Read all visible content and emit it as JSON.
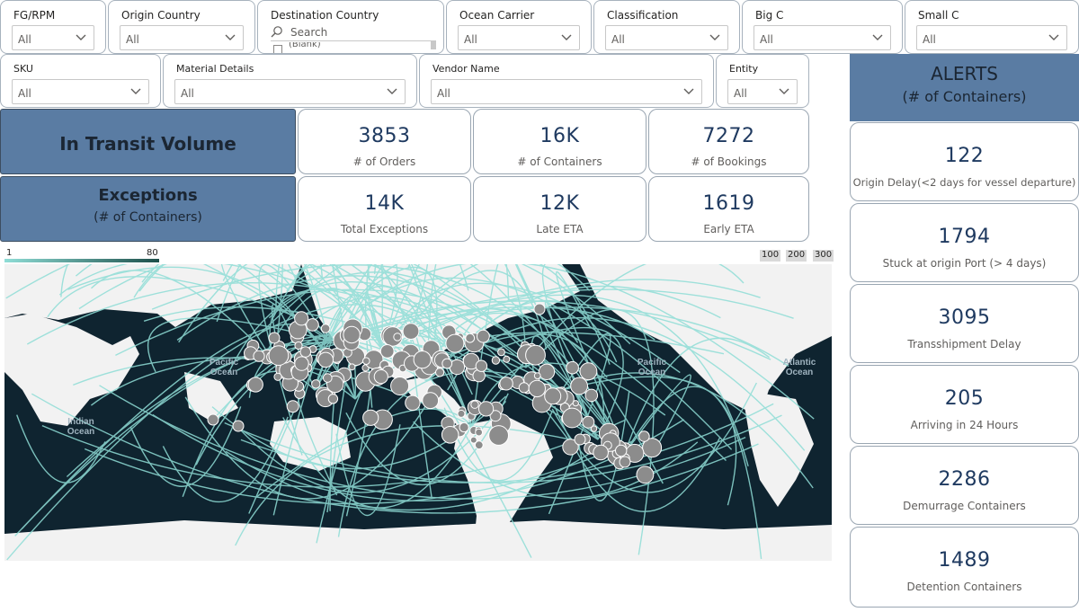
{
  "filters_row1": [
    {
      "title": "FG/RPM",
      "value": "All"
    },
    {
      "title": "Origin Country",
      "value": "All"
    },
    {
      "title": "Destination Country",
      "search_placeholder": "Search",
      "first_item": "(Blank)"
    },
    {
      "title": "Ocean Carrier",
      "value": "All"
    },
    {
      "title": "Classification",
      "value": "All"
    },
    {
      "title": "Big C",
      "value": "All"
    },
    {
      "title": "Small C",
      "value": "All"
    }
  ],
  "filters_row2": [
    {
      "title": "SKU",
      "value": "All"
    },
    {
      "title": "Material Details",
      "value": "All"
    },
    {
      "title": "Vendor Name",
      "value": "All"
    },
    {
      "title": "Entity",
      "value": "All"
    }
  ],
  "in_transit": {
    "title": "In Transit Volume",
    "kpis": [
      {
        "value": "3853",
        "label": "# of Orders"
      },
      {
        "value": "16K",
        "label": "# of Containers"
      },
      {
        "value": "7272",
        "label": "# of Bookings"
      }
    ]
  },
  "exceptions": {
    "title": "Exceptions",
    "subtitle": "(# of Containers)",
    "kpis": [
      {
        "value": "14K",
        "label": "Total Exceptions"
      },
      {
        "value": "12K",
        "label": "Late ETA"
      },
      {
        "value": "1619",
        "label": "Early ETA"
      }
    ]
  },
  "alerts": {
    "title": "ALERTS",
    "subtitle": "(# of Containers)",
    "items": [
      {
        "value": "122",
        "label": "Origin Delay(<2 days for vessel departure)"
      },
      {
        "value": "1794",
        "label": "Stuck at origin Port (> 4 days)"
      },
      {
        "value": "3095",
        "label": "Transshipment Delay"
      },
      {
        "value": "205",
        "label": "Arriving in 24 Hours"
      },
      {
        "value": "2286",
        "label": "Demurrage Containers"
      },
      {
        "value": "1489",
        "label": "Detention Containers"
      }
    ]
  },
  "map": {
    "color_legend_min": "1",
    "color_legend_max": "80",
    "size_legend": [
      "100",
      "200",
      "300"
    ],
    "ocean_labels": [
      {
        "line1": "Pacific",
        "line2": "Ocean"
      },
      {
        "line1": "Indian",
        "line2": "Ocean"
      },
      {
        "line1": "Pacific",
        "line2": "Ocean"
      },
      {
        "line1": "Atlantic",
        "line2": "Ocean"
      }
    ],
    "colors": {
      "route": "#8fddd6",
      "bubble": "#8c8c8c",
      "water": "#0f2430",
      "land": "#f2f2f2"
    }
  }
}
